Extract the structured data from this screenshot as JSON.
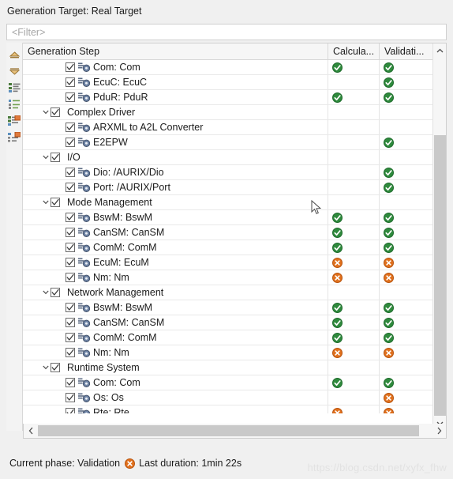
{
  "header": {
    "generation_target_label": "Generation Target: Real Target"
  },
  "filter": {
    "placeholder": "<Filter>",
    "value": ""
  },
  "left_toolbar": {
    "items": [
      {
        "name": "collapse-all-icon",
        "title": "Collapse All"
      },
      {
        "name": "expand-all-icon",
        "title": "Expand All"
      },
      {
        "name": "group-by-module-icon",
        "title": "Group By Module"
      },
      {
        "name": "flat-list-icon",
        "title": "Flat List"
      },
      {
        "name": "filter-calculation-icon",
        "title": "Filter Calculation"
      },
      {
        "name": "filter-validation-icon",
        "title": "Filter Validation"
      }
    ]
  },
  "table": {
    "columns": [
      {
        "key": "name",
        "label": "Generation Step"
      },
      {
        "key": "calculation",
        "label": "Calcula..."
      },
      {
        "key": "validation",
        "label": "Validati..."
      }
    ],
    "rows": [
      {
        "label": "Com: Com",
        "type": "leaf",
        "indent": 2,
        "checked": true,
        "calculation": "ok",
        "validation": "ok"
      },
      {
        "label": "EcuC: EcuC",
        "type": "leaf",
        "indent": 2,
        "checked": true,
        "calculation": "none",
        "validation": "ok"
      },
      {
        "label": "PduR: PduR",
        "type": "leaf",
        "indent": 2,
        "checked": true,
        "calculation": "ok",
        "validation": "ok"
      },
      {
        "label": "Complex Driver",
        "type": "group",
        "indent": 1,
        "checked": true,
        "expanded": true,
        "calculation": "none",
        "validation": "none"
      },
      {
        "label": "ARXML to A2L Converter",
        "type": "leaf",
        "indent": 2,
        "checked": true,
        "calculation": "none",
        "validation": "none"
      },
      {
        "label": "E2EPW",
        "type": "leaf",
        "indent": 2,
        "checked": true,
        "calculation": "none",
        "validation": "ok"
      },
      {
        "label": "I/O",
        "type": "group",
        "indent": 1,
        "checked": true,
        "expanded": true,
        "calculation": "none",
        "validation": "none"
      },
      {
        "label": "Dio: /AURIX/Dio",
        "type": "leaf",
        "indent": 2,
        "checked": true,
        "calculation": "none",
        "validation": "ok"
      },
      {
        "label": "Port: /AURIX/Port",
        "type": "leaf",
        "indent": 2,
        "checked": true,
        "calculation": "none",
        "validation": "ok"
      },
      {
        "label": "Mode Management",
        "type": "group",
        "indent": 1,
        "checked": true,
        "expanded": true,
        "calculation": "none",
        "validation": "none"
      },
      {
        "label": "BswM: BswM",
        "type": "leaf",
        "indent": 2,
        "checked": true,
        "calculation": "ok",
        "validation": "ok"
      },
      {
        "label": "CanSM: CanSM",
        "type": "leaf",
        "indent": 2,
        "checked": true,
        "calculation": "ok",
        "validation": "ok"
      },
      {
        "label": "ComM: ComM",
        "type": "leaf",
        "indent": 2,
        "checked": true,
        "calculation": "ok",
        "validation": "ok"
      },
      {
        "label": "EcuM: EcuM",
        "type": "leaf",
        "indent": 2,
        "checked": true,
        "calculation": "error",
        "validation": "error"
      },
      {
        "label": "Nm: Nm",
        "type": "leaf",
        "indent": 2,
        "checked": true,
        "calculation": "error",
        "validation": "error"
      },
      {
        "label": "Network Management",
        "type": "group",
        "indent": 1,
        "checked": true,
        "expanded": true,
        "calculation": "none",
        "validation": "none"
      },
      {
        "label": "BswM: BswM",
        "type": "leaf",
        "indent": 2,
        "checked": true,
        "calculation": "ok",
        "validation": "ok"
      },
      {
        "label": "CanSM: CanSM",
        "type": "leaf",
        "indent": 2,
        "checked": true,
        "calculation": "ok",
        "validation": "ok"
      },
      {
        "label": "ComM: ComM",
        "type": "leaf",
        "indent": 2,
        "checked": true,
        "calculation": "ok",
        "validation": "ok"
      },
      {
        "label": "Nm: Nm",
        "type": "leaf",
        "indent": 2,
        "checked": true,
        "calculation": "error",
        "validation": "error"
      },
      {
        "label": "Runtime System",
        "type": "group",
        "indent": 1,
        "checked": true,
        "expanded": true,
        "calculation": "none",
        "validation": "none"
      },
      {
        "label": "Com: Com",
        "type": "leaf",
        "indent": 2,
        "checked": true,
        "calculation": "ok",
        "validation": "ok"
      },
      {
        "label": "Os: Os",
        "type": "leaf",
        "indent": 2,
        "checked": true,
        "calculation": "none",
        "validation": "error"
      },
      {
        "label": "Rte: Rte",
        "type": "leaf",
        "indent": 2,
        "checked": true,
        "calculation": "error",
        "validation": "error"
      }
    ]
  },
  "scrollbars": {
    "vertical": {
      "up_arrow": "chevron-up-icon",
      "down_arrow": "chevron-down-icon"
    },
    "horizontal": {
      "left_arrow": "chevron-left-icon",
      "right_arrow": "chevron-right-icon"
    }
  },
  "status_bar": {
    "phase_text": "Current phase: Validation",
    "phase_icon": "error",
    "duration_text": "Last duration: 1min 22s"
  },
  "watermark": {
    "text": "https://blog.csdn.net/xyfx_fhw"
  },
  "colors": {
    "ok": "#2f8a3d",
    "error": "#e0701d",
    "accent": "#1b1b1b",
    "panel": "#f0f0f0",
    "scroll_thumb": "#c9c9c9"
  }
}
